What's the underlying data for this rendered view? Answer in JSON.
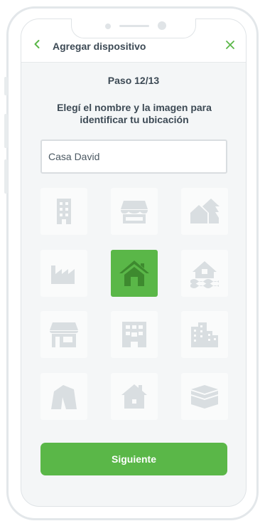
{
  "header": {
    "title": "Agregar dispositivo",
    "back_icon": "chevron-left-icon",
    "close_icon": "close-icon"
  },
  "step_label": "Paso 12/13",
  "instructions": "Elegí el nombre y la imagen para identificar tu ubicación",
  "name_input": {
    "value": "Casa David"
  },
  "location_icons": [
    {
      "name": "building-icon",
      "selected": false
    },
    {
      "name": "store-icon",
      "selected": false
    },
    {
      "name": "houses-icon",
      "selected": false
    },
    {
      "name": "factory-icon",
      "selected": false
    },
    {
      "name": "house-icon",
      "selected": true
    },
    {
      "name": "beach-house-icon",
      "selected": false
    },
    {
      "name": "shop-icon",
      "selected": false
    },
    {
      "name": "hotel-icon",
      "selected": false
    },
    {
      "name": "city-icon",
      "selected": false
    },
    {
      "name": "tent-icon",
      "selected": false
    },
    {
      "name": "home-icon",
      "selected": false
    },
    {
      "name": "kaaba-icon",
      "selected": false
    }
  ],
  "next_button": {
    "label": "Siguiente"
  },
  "colors": {
    "accent": "#5ab748",
    "accent_dark": "#3e8a2f",
    "text": "#3d4a55",
    "icon_inactive": "#d9dee1"
  }
}
